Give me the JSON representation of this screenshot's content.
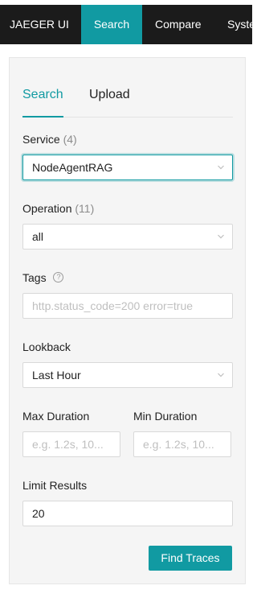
{
  "nav": {
    "brand": "JAEGER UI",
    "tabs": [
      "Search",
      "Compare",
      "Syste"
    ]
  },
  "panel_tabs": {
    "search": "Search",
    "upload": "Upload"
  },
  "form": {
    "service": {
      "label": "Service",
      "count": "(4)",
      "value": "NodeAgentRAG"
    },
    "operation": {
      "label": "Operation",
      "count": "(11)",
      "value": "all"
    },
    "tags": {
      "label": "Tags",
      "placeholder": "http.status_code=200 error=true"
    },
    "lookback": {
      "label": "Lookback",
      "value": "Last Hour"
    },
    "max_duration": {
      "label": "Max Duration",
      "placeholder": "e.g. 1.2s, 10..."
    },
    "min_duration": {
      "label": "Min Duration",
      "placeholder": "e.g. 1.2s, 10..."
    },
    "limit": {
      "label": "Limit Results",
      "value": "20"
    },
    "submit_label": "Find Traces"
  },
  "colors": {
    "accent": "#119aa2",
    "nav_bg": "#1b1b1b",
    "panel_bg": "#f5f5f5"
  },
  "icons": {
    "select_arrow": "chevron-down-icon",
    "tags_help": "question-circle-icon"
  }
}
